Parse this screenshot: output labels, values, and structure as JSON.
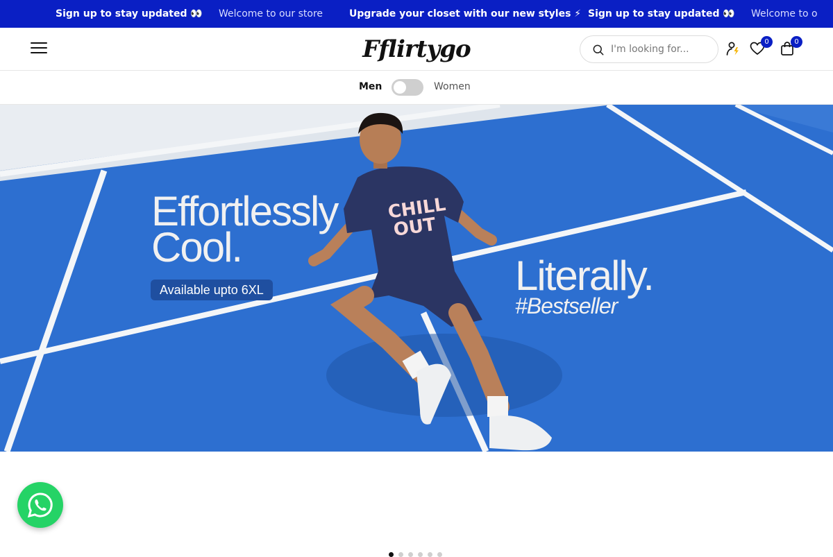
{
  "announcement": {
    "items": [
      {
        "text": "Sign up to stay updated 👀",
        "bold": true
      },
      {
        "text": "Welcome to our store",
        "bold": false
      },
      {
        "text": "Upgrade your closet with our new styles ⚡",
        "bold": true
      },
      {
        "text": "Sign up to stay updated 👀",
        "bold": true
      },
      {
        "text": "Welcome to o",
        "bold": false
      }
    ]
  },
  "header": {
    "logo": "Fflirtygo",
    "search_placeholder": "I'm looking for...",
    "wishlist_count": "0",
    "cart_count": "0"
  },
  "gender_toggle": {
    "left_label": "Men",
    "right_label": "Women",
    "selected": "Men"
  },
  "hero": {
    "headline_line1": "Effortlessly",
    "headline_line2": "Cool.",
    "pill": "Available upto 6XL",
    "tagline": "Literally.",
    "hashtag": "#Bestseller"
  },
  "slider": {
    "total": 6,
    "active_index": 0
  },
  "colors": {
    "brand": "#0a1fc4",
    "court": "#2a6fcc",
    "whatsapp": "#25d366"
  }
}
